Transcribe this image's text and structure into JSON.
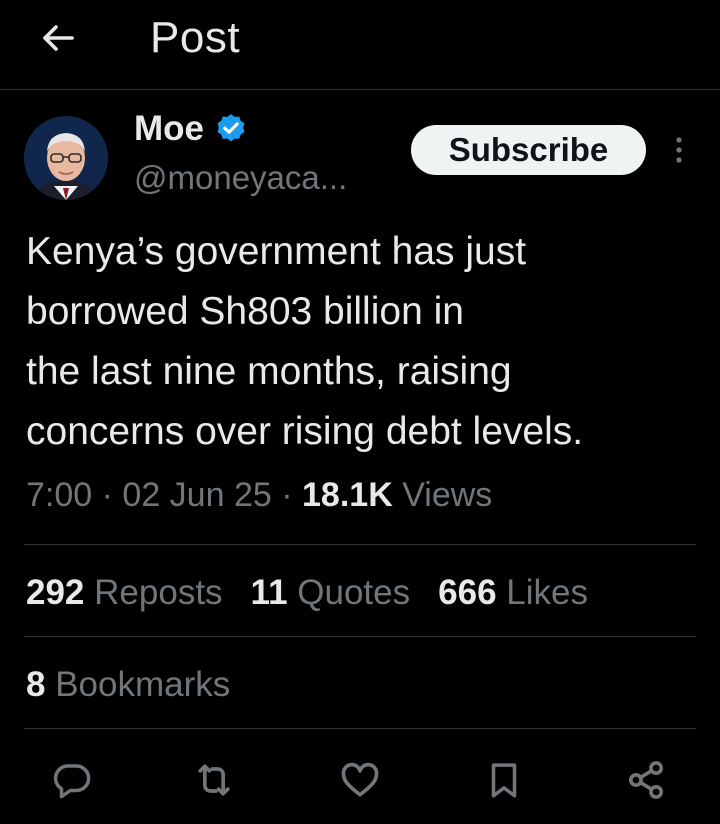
{
  "header": {
    "title": "Post",
    "back_icon": "arrow-left-icon"
  },
  "post": {
    "author": {
      "name": "Moe",
      "handle": "@moneyaca...",
      "verified": true,
      "verified_color": "#1d9bf0"
    },
    "subscribe_label": "Subscribe",
    "text_lines": [
      "Kenya’s government has just",
      "borrowed Sh803 billion in",
      "the last nine months, raising",
      "concerns over rising debt levels."
    ],
    "time": "7:00",
    "date": "02 Jun 25",
    "separator": "·",
    "views_count": "18.1K",
    "views_label": "Views"
  },
  "stats": {
    "reposts": {
      "count": "292",
      "label": "Reposts"
    },
    "quotes": {
      "count": "11",
      "label": "Quotes"
    },
    "likes": {
      "count": "666",
      "label": "Likes"
    },
    "bookmarks": {
      "count": "8",
      "label": "Bookmarks"
    }
  },
  "actions": [
    {
      "name": "reply",
      "icon": "comment-icon"
    },
    {
      "name": "repost",
      "icon": "repost-icon"
    },
    {
      "name": "like",
      "icon": "heart-icon"
    },
    {
      "name": "bookmark",
      "icon": "bookmark-icon"
    },
    {
      "name": "share",
      "icon": "share-icon"
    }
  ],
  "colors": {
    "background": "#000000",
    "text_primary": "#e7e9ea",
    "text_secondary": "#71767b",
    "divider": "#2f3336",
    "accent": "#1d9bf0"
  }
}
